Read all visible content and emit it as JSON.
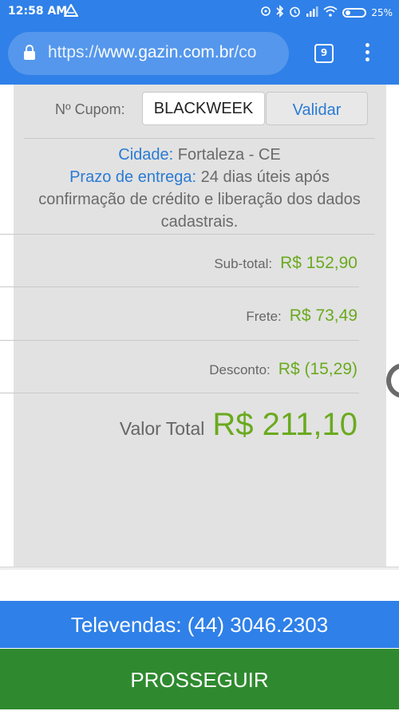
{
  "statusbar": {
    "time": "12:58 AM",
    "battery": "25%",
    "icons": [
      "alert-triangle-icon",
      "hotspot-icon",
      "bluetooth-icon",
      "alarm-icon",
      "signal-icon",
      "wifi-icon",
      "battery-icon"
    ]
  },
  "browser": {
    "url_scheme": "https://",
    "url_host": "www.gazin.com.br",
    "url_path": "/co",
    "tab_count": "9"
  },
  "coupon": {
    "label": "Nº Cupom:",
    "value": "BLACKWEEK",
    "validate_label": "Validar"
  },
  "delivery": {
    "city_label": "Cidade:",
    "city_value": "Fortaleza - CE",
    "deadline_label": "Prazo de entrega:",
    "deadline_value": "24 dias úteis após confirmação de crédito e liberação dos dados cadastrais."
  },
  "summary": {
    "subtotal_label": "Sub-total:",
    "subtotal_value": "R$ 152,90",
    "shipping_label": "Frete:",
    "shipping_value": "R$ 73,49",
    "discount_label": "Desconto:",
    "discount_value": "R$ (15,29)",
    "total_label": "Valor Total",
    "total_value": "R$ 211,10"
  },
  "footer": {
    "televendas": "Televendas: (44) 3046.2303",
    "proceed_label": "PROSSEGUIR"
  },
  "colors": {
    "brand_blue": "#2f80e8",
    "price_green": "#6aaa1e",
    "proceed_green": "#2f8a2f",
    "link_blue": "#2a7bd4"
  }
}
